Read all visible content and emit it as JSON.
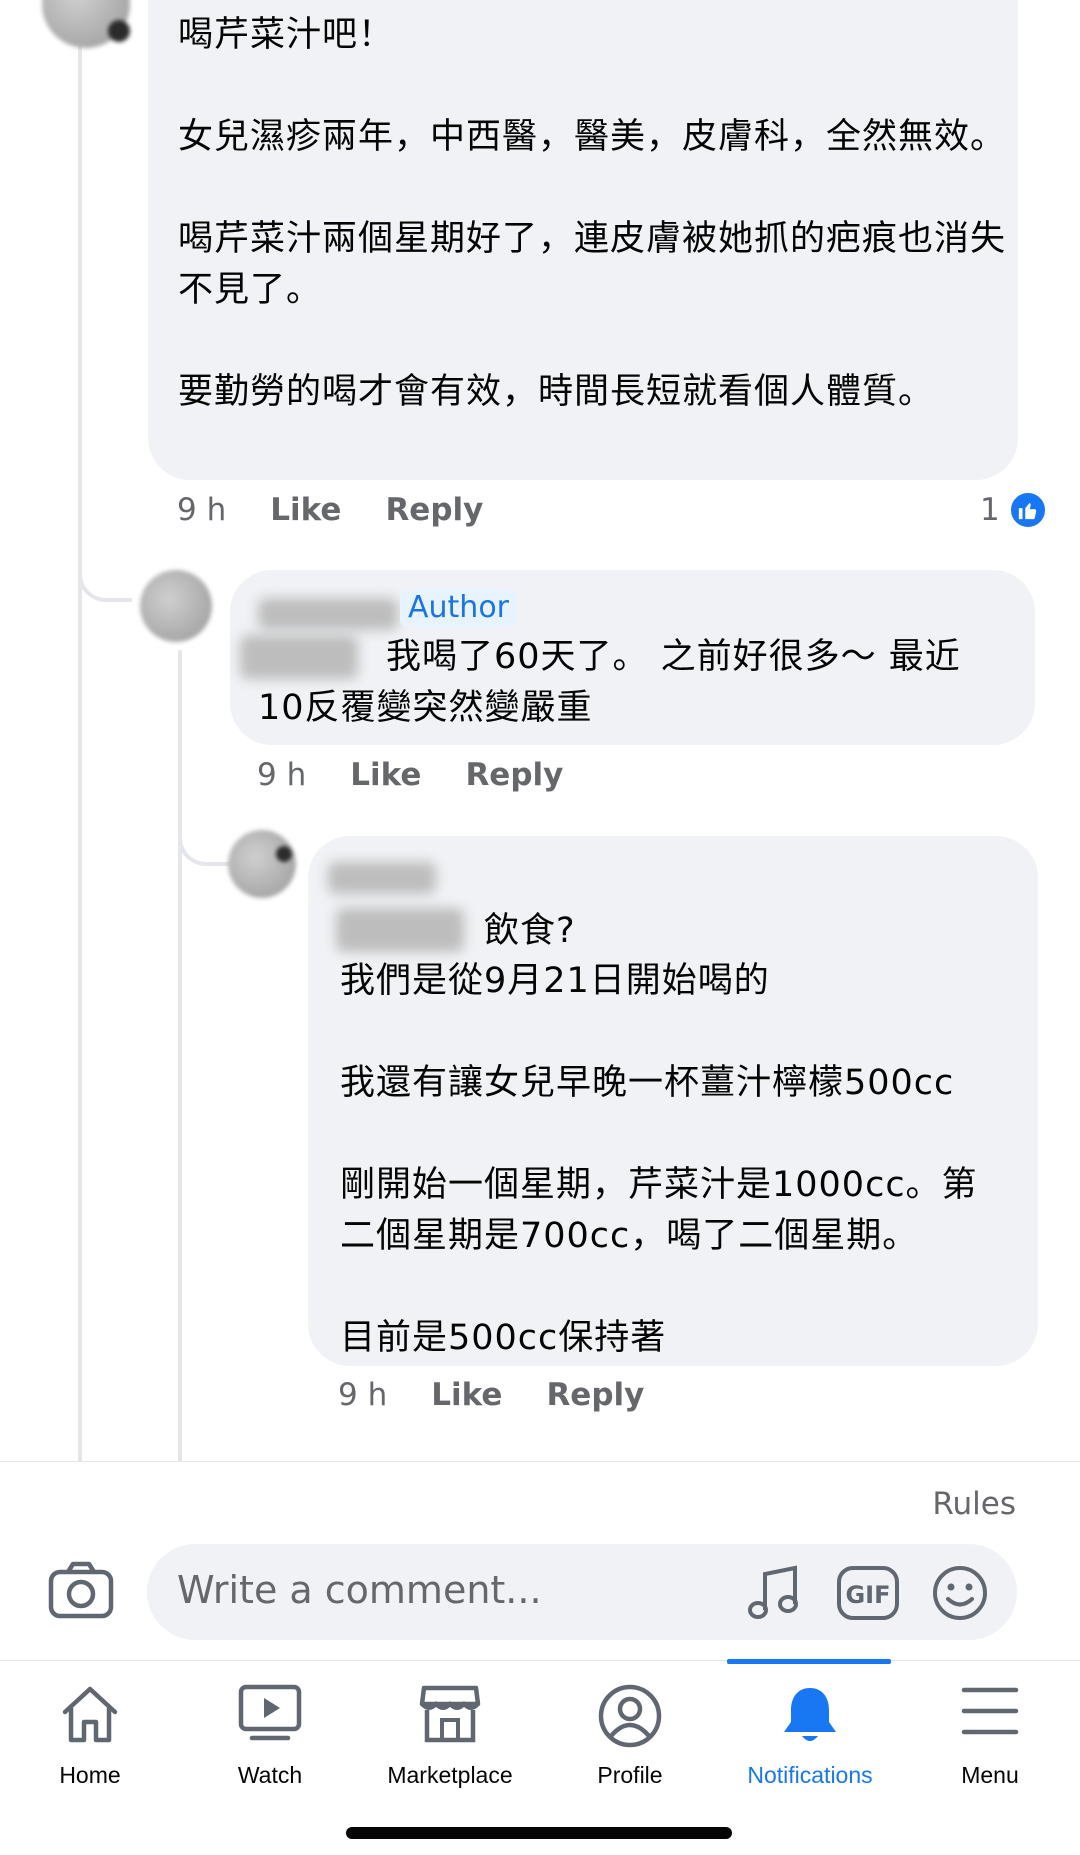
{
  "comments": [
    {
      "text": "喝芹菜汁吧！\n\n女兒濕疹兩年，中西醫，醫美，皮膚科，全然無效。\n\n喝芹菜汁兩個星期好了，連皮膚被她抓的疤痕也消失不見了。\n\n要勤勞的喝才會有效，時間長短就看個人體質。",
      "time": "9 h",
      "like": "Like",
      "reply": "Reply",
      "reaction_count": "1"
    },
    {
      "badge": "Author",
      "text": "我喝了60天了。 之前好很多～ 最近\n10反覆變突然變嚴重",
      "time": "9 h",
      "like": "Like",
      "reply": "Reply"
    },
    {
      "text_first": "飲食?",
      "text": "我們是從9月21日開始喝的\n\n我還有讓女兒早晚一杯薑汁檸檬500cc\n\n剛開始一個星期，芹菜汁是1000cc。第\n二個星期是700cc，喝了二個星期。\n\n目前是500cc保持著",
      "time": "9 h",
      "like": "Like",
      "reply": "Reply"
    }
  ],
  "composer": {
    "rules": "Rules",
    "placeholder": "Write a comment...",
    "icons": [
      "camera-icon",
      "music-note-icon",
      "gif-icon",
      "emoji-icon"
    ]
  },
  "nav": {
    "items": [
      {
        "label": "Home",
        "icon": "home-icon"
      },
      {
        "label": "Watch",
        "icon": "watch-icon"
      },
      {
        "label": "Marketplace",
        "icon": "marketplace-icon"
      },
      {
        "label": "Profile",
        "icon": "profile-icon"
      },
      {
        "label": "Notifications",
        "icon": "bell-icon",
        "active": true
      },
      {
        "label": "Menu",
        "icon": "menu-icon"
      }
    ]
  },
  "colors": {
    "accent": "#1877f2",
    "bubble": "#f0f2f5",
    "meta": "#65676b"
  }
}
